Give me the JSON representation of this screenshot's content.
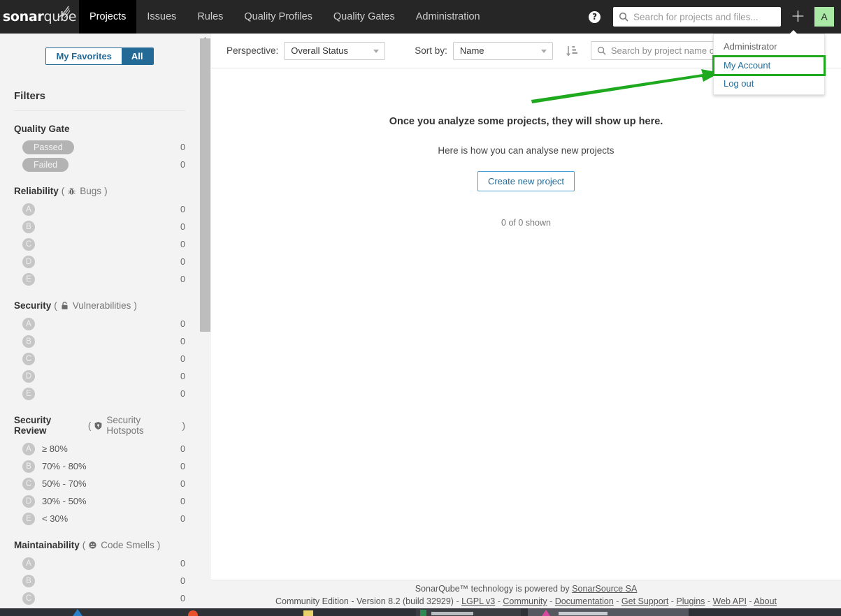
{
  "navbar": {
    "brand_bold": "sonar",
    "brand_light": "qube",
    "links": [
      {
        "label": "Projects",
        "active": true
      },
      {
        "label": "Issues",
        "active": false
      },
      {
        "label": "Rules",
        "active": false
      },
      {
        "label": "Quality Profiles",
        "active": false
      },
      {
        "label": "Quality Gates",
        "active": false
      },
      {
        "label": "Administration",
        "active": false
      }
    ],
    "help_icon": "help-icon",
    "search_placeholder": "Search for projects and files...",
    "search_value": "",
    "plus_label": "+",
    "avatar_initial": "A"
  },
  "user_menu": {
    "header": "Administrator",
    "items": [
      {
        "label": "My Account",
        "highlighted": true
      },
      {
        "label": "Log out",
        "highlighted": false
      }
    ]
  },
  "sidebar": {
    "favorites_toggle": [
      {
        "label": "My Favorites",
        "active": false
      },
      {
        "label": "All",
        "active": true
      }
    ],
    "filters_title": "Filters",
    "facets": [
      {
        "name": "Quality Gate",
        "metric": "",
        "icon": "",
        "type": "pill",
        "rows": [
          {
            "label": "Passed",
            "count": "0"
          },
          {
            "label": "Failed",
            "count": "0"
          }
        ]
      },
      {
        "name": "Reliability",
        "metric": "Bugs",
        "icon": "bug-icon",
        "type": "rating",
        "rows": [
          {
            "rating": "A",
            "label": "",
            "count": "0"
          },
          {
            "rating": "B",
            "label": "",
            "count": "0"
          },
          {
            "rating": "C",
            "label": "",
            "count": "0"
          },
          {
            "rating": "D",
            "label": "",
            "count": "0"
          },
          {
            "rating": "E",
            "label": "",
            "count": "0"
          }
        ]
      },
      {
        "name": "Security",
        "metric": "Vulnerabilities",
        "icon": "lock-icon",
        "type": "rating",
        "rows": [
          {
            "rating": "A",
            "label": "",
            "count": "0"
          },
          {
            "rating": "B",
            "label": "",
            "count": "0"
          },
          {
            "rating": "C",
            "label": "",
            "count": "0"
          },
          {
            "rating": "D",
            "label": "",
            "count": "0"
          },
          {
            "rating": "E",
            "label": "",
            "count": "0"
          }
        ]
      },
      {
        "name": "Security Review",
        "metric": "Security Hotspots",
        "icon": "shield-icon",
        "type": "rating",
        "rows": [
          {
            "rating": "A",
            "label": "≥ 80%",
            "count": "0"
          },
          {
            "rating": "B",
            "label": "70% - 80%",
            "count": "0"
          },
          {
            "rating": "C",
            "label": "50% - 70%",
            "count": "0"
          },
          {
            "rating": "D",
            "label": "30% - 50%",
            "count": "0"
          },
          {
            "rating": "E",
            "label": "< 30%",
            "count": "0"
          }
        ]
      },
      {
        "name": "Maintainability",
        "metric": "Code Smells",
        "icon": "code-smell-icon",
        "type": "rating",
        "rows": [
          {
            "rating": "A",
            "label": "",
            "count": "0"
          },
          {
            "rating": "B",
            "label": "",
            "count": "0"
          },
          {
            "rating": "C",
            "label": "",
            "count": "0"
          }
        ]
      }
    ]
  },
  "toolbar": {
    "perspective_label": "Perspective:",
    "perspective_value": "Overall Status",
    "sortby_label": "Sort by:",
    "sortby_value": "Name",
    "sort_order_icon": "sort-descending-icon",
    "project_search_placeholder": "Search by project name or key",
    "project_search_value": ""
  },
  "empty_state": {
    "title": "Once you analyze some projects, they will show up here.",
    "subtitle": "Here is how you can analyse new projects",
    "button_label": "Create new project",
    "shown_count": "0 of 0 shown"
  },
  "footer": {
    "line1_prefix": "SonarQube™ technology is powered by ",
    "line1_link": "SonarSource SA",
    "links": [
      "Community Edition - Version 8.2 (build 32929)",
      "LGPL v3",
      "Community",
      "Documentation",
      "Get Support",
      "Plugins",
      "Web API",
      "About"
    ]
  },
  "colors": {
    "accent_blue": "#236a97",
    "navbar_bg": "#262626",
    "annotation_green": "#1fa91f",
    "avatar_green": "#a9e8a5",
    "rating_grey": "#c6c6c6"
  }
}
